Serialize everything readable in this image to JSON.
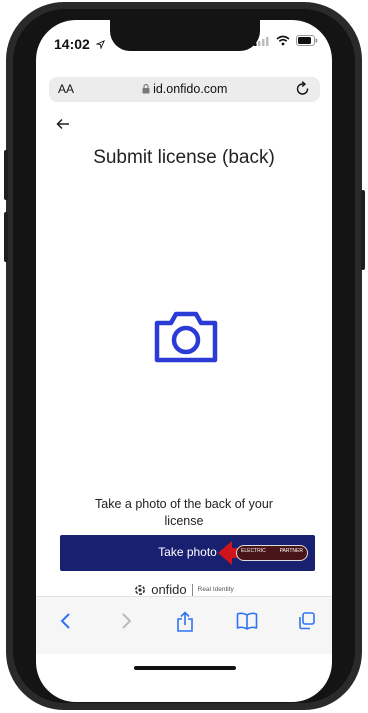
{
  "status_bar": {
    "time": "14:02"
  },
  "browser": {
    "text_size_label": "AA",
    "url": "id.onfido.com"
  },
  "page": {
    "title": "Submit license (back)",
    "prompt": "Take a photo of the back of your license",
    "primary_button": "Take photo"
  },
  "overlay_badge": {
    "left_text": "ELECTRIC",
    "right_text": "PARTNER"
  },
  "footer": {
    "brand": "onfido",
    "tagline": "Real Identity"
  },
  "colors": {
    "accent": "#2b3bd6",
    "button_bg": "#1a2070",
    "overlay_arrow": "#d0141e"
  }
}
